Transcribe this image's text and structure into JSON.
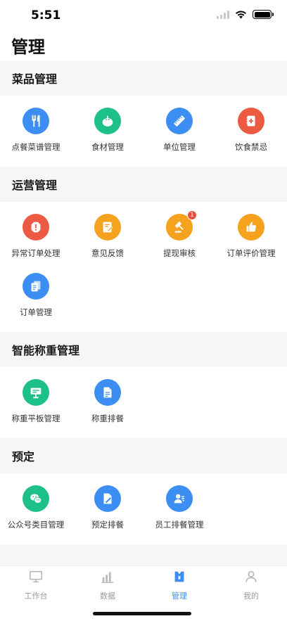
{
  "status_bar": {
    "time": "5:51"
  },
  "header": {
    "title": "管理"
  },
  "colors": {
    "blue": "#3d8ef2",
    "green": "#1ec08a",
    "red": "#ec5a43",
    "orange": "#f5a21f",
    "tab_active": "#3d8ef2",
    "tab_inactive": "#b9b9b9"
  },
  "sections": [
    {
      "title": "菜品管理",
      "items": [
        {
          "label": "点餐菜谱管理",
          "icon": "fork-knife-icon",
          "color": "#3d8ef2"
        },
        {
          "label": "食材管理",
          "icon": "tomato-icon",
          "color": "#1ec08a"
        },
        {
          "label": "单位管理",
          "icon": "ruler-icon",
          "color": "#3d8ef2"
        },
        {
          "label": "饮食禁忌",
          "icon": "medical-book-icon",
          "color": "#ec5a43"
        }
      ]
    },
    {
      "title": "运营管理",
      "items": [
        {
          "label": "异常订单处理",
          "icon": "alert-icon",
          "color": "#ec5a43"
        },
        {
          "label": "意见反馈",
          "icon": "feedback-icon",
          "color": "#f5a21f"
        },
        {
          "label": "提现审核",
          "icon": "gavel-icon",
          "color": "#f5a21f",
          "badge": "1"
        },
        {
          "label": "订单评价管理",
          "icon": "thumbs-up-icon",
          "color": "#f5a21f"
        },
        {
          "label": "订单管理",
          "icon": "documents-icon",
          "color": "#3d8ef2"
        }
      ]
    },
    {
      "title": "智能称重管理",
      "items": [
        {
          "label": "称重平板管理",
          "icon": "tablet-stand-icon",
          "color": "#1ec08a"
        },
        {
          "label": "称重排餐",
          "icon": "document-icon",
          "color": "#3d8ef2"
        }
      ]
    },
    {
      "title": "预定",
      "items": [
        {
          "label": "公众号类目管理",
          "icon": "wechat-icon",
          "color": "#1ec08a"
        },
        {
          "label": "预定排餐",
          "icon": "edit-document-icon",
          "color": "#3d8ef2"
        },
        {
          "label": "员工排餐管理",
          "icon": "employee-icon",
          "color": "#3d8ef2"
        }
      ]
    }
  ],
  "tab_bar": {
    "tabs": [
      {
        "label": "工作台",
        "icon": "monitor-icon",
        "active": false
      },
      {
        "label": "数据",
        "icon": "bar-chart-icon",
        "active": false
      },
      {
        "label": "管理",
        "icon": "manage-icon",
        "active": true
      },
      {
        "label": "我的",
        "icon": "person-icon",
        "active": false
      }
    ]
  }
}
